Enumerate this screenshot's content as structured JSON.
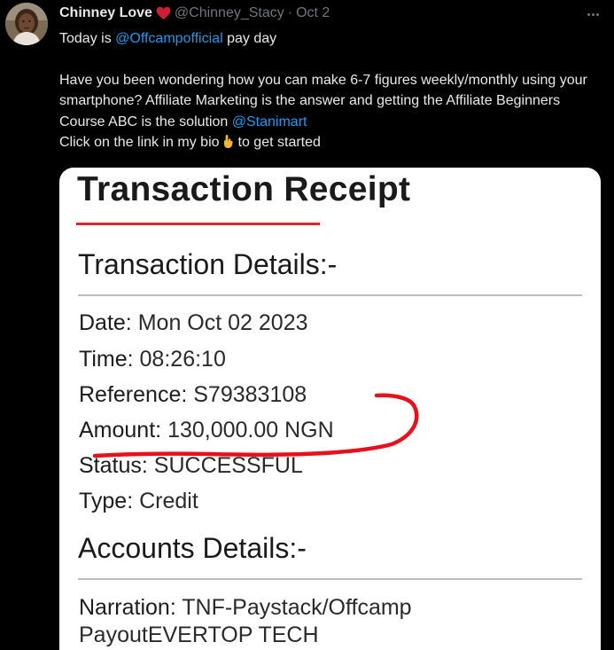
{
  "tweet": {
    "display_name": "Chinney Love",
    "handle": "@Chinney_Stacy",
    "separator": "·",
    "date": "Oct 2",
    "line1_prefix": "Today is ",
    "line1_mention": "@Offcampofficial",
    "line1_suffix": " pay day",
    "para2_text": "Have you been wondering how you can make 6-7 figures weekly/monthly using your smartphone? Affiliate Marketing is the answer and getting the Affiliate Beginners Course ABC is the solution ",
    "para2_mention": "@Stanimart",
    "line3_prefix": "Click on the link in my bio",
    "line3_suffix": "to get started"
  },
  "receipt": {
    "title": "Transaction Receipt",
    "section1": "Transaction Details:-",
    "date_label": "Date:",
    "date_value": "Mon Oct 02 2023",
    "time_label": "Time:",
    "time_value": "08:26:10",
    "ref_label": "Reference:",
    "ref_value": "S79383108",
    "amount_label": "Amount:",
    "amount_value": "130,000.00 NGN",
    "status_label": "Status:",
    "status_value": "SUCCESSFUL",
    "type_label": "Type:",
    "type_value": "Credit",
    "section2": "Accounts Details:-",
    "narration_label": "Narration:",
    "narration_value1": "TNF-Paystack/Offcamp",
    "narration_value2": "PayoutEVERTOP TECH"
  },
  "icons": {
    "heart": "heart-icon",
    "hand": "raised-hand-icon",
    "more": "more-options-icon"
  },
  "colors": {
    "background": "#000000",
    "text": "#e7e9ea",
    "muted": "#71767b",
    "link": "#1d9bf0",
    "heart": "#d01e37",
    "accent_red": "#d8262c",
    "scribble": "#e8101a"
  }
}
